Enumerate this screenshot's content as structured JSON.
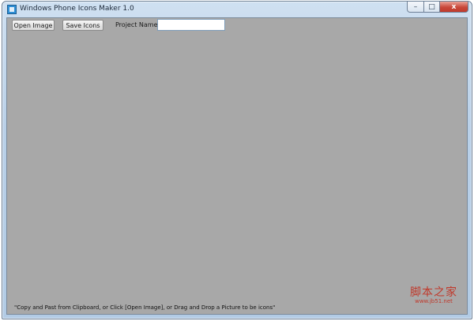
{
  "window": {
    "title": "Windows Phone Icons Maker 1.0",
    "controls": {
      "minimize": "–",
      "maximize": "□",
      "close": "x"
    }
  },
  "toolbar": {
    "open_label": "Open Image",
    "save_label": "Save Icons",
    "project_label": "Project Name",
    "project_value": ""
  },
  "content": {
    "hint": "\"Copy and Past from Clipboard, or Click [Open Image], or Drag and Drop a Picture to be icons\""
  },
  "watermark": {
    "text": "脚本之家",
    "url": "www.jb51.net"
  },
  "colors": {
    "canvas": "#a8a8a8",
    "watermark": "#c0392b"
  }
}
